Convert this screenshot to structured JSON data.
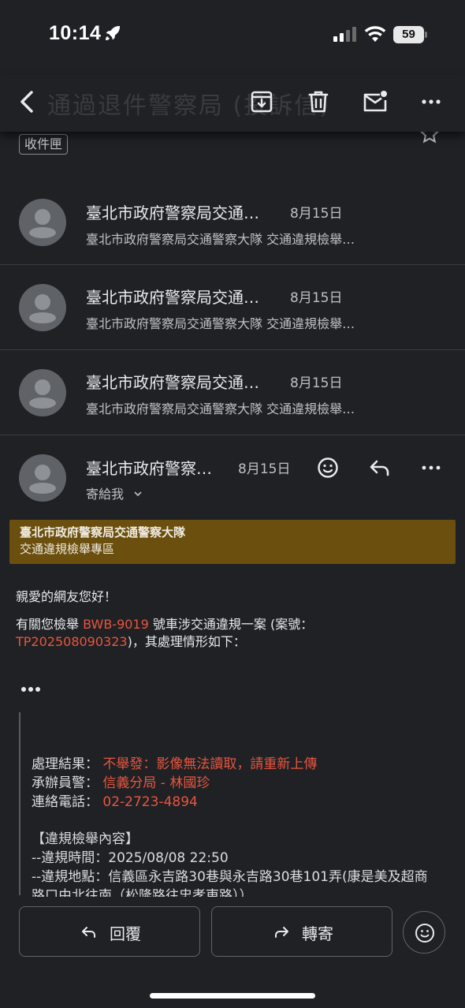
{
  "status": {
    "time": "10:14",
    "battery": "59"
  },
  "toolbar": {
    "ghost_subject": "通過退件警察局 (投訴信)"
  },
  "label": "收件匣",
  "messages": [
    {
      "sender": "臺北市政府警察局交通…",
      "date": "8月15日",
      "snippet": "臺北市政府警察局交通警察大隊 交通違規檢舉…"
    },
    {
      "sender": "臺北市政府警察局交通…",
      "date": "8月15日",
      "snippet": "臺北市政府警察局交通警察大隊 交通違規檢舉…"
    },
    {
      "sender": "臺北市政府警察局交通…",
      "date": "8月15日",
      "snippet": "臺北市政府警察局交通警察大隊 交通違規檢舉…"
    }
  ],
  "open_message": {
    "sender": "臺北市政府警察…",
    "date": "8月15日",
    "to": "寄給我"
  },
  "banner": {
    "line1": "臺北市政府警察局交通警察大隊",
    "line2": "交通違規檢舉專區"
  },
  "body": {
    "greeting": "親愛的網友您好！",
    "line1_a": "有關您檢舉 ",
    "plate": "BWB-9019",
    "line1_b": " 號車涉交通違規一案 (案號：",
    "case_no": "TP202508090323",
    "line2_b": ")，其處理情形如下："
  },
  "quote": {
    "result_label": "處理結果：",
    "result_value": "不舉發：影像無法讀取，請重新上傳",
    "officer_label": "承辦員警：",
    "officer_value": "信義分局 - 林國珍",
    "phone_label": "連絡電話：",
    "phone_value": "02-2723-4894",
    "section_title": "【違規檢舉內容】",
    "time_line": "--違規時間：2025/08/08 22:50",
    "place_line": "--違規地點：信義區永吉路30巷與永吉路30巷101弄(康是美及超商",
    "place_line2": "路口由北往南（松隆路往忠孝東路））"
  },
  "actions": {
    "reply": "回覆",
    "forward": "轉寄"
  }
}
